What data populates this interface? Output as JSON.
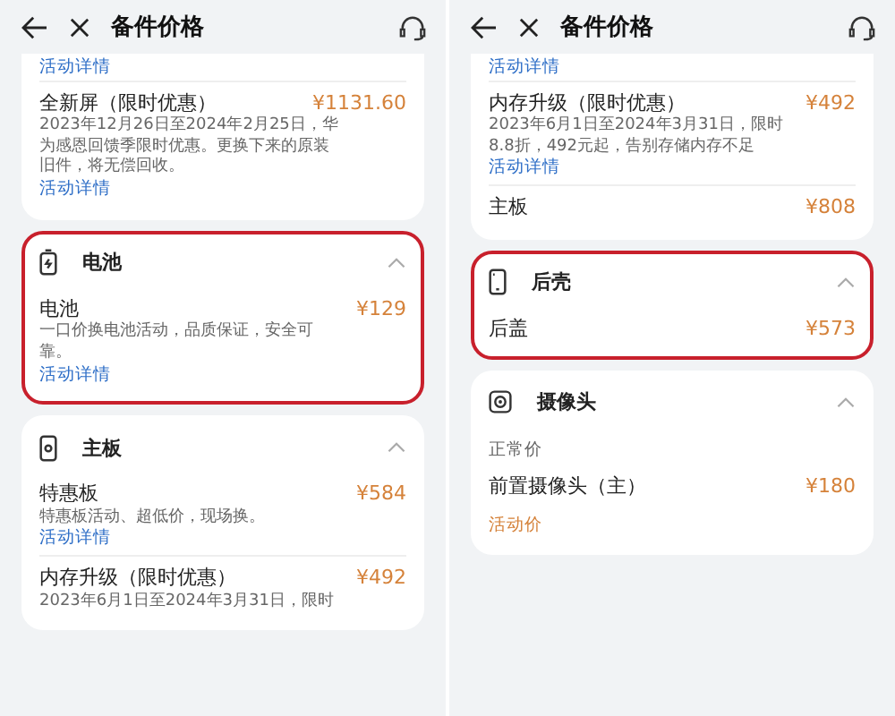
{
  "panels": [
    {
      "title": "备件价格",
      "cards": [
        {
          "highlighted": false,
          "items": [
            {
              "kind": "link",
              "link": "活动详情"
            },
            {
              "kind": "item",
              "name": "全新屏（限时优惠）",
              "price": "¥1131.60",
              "desc": "2023年12月26日至2024年2月25日，华为感恩回馈季限时优惠。更换下来的原装旧件，将无偿回收。",
              "link": "活动详情"
            }
          ]
        },
        {
          "highlighted": true,
          "kind": "battery",
          "title": "电池",
          "expanded": true,
          "items": [
            {
              "kind": "item",
              "name": "电池",
              "price": "¥129",
              "desc": "一口价换电池活动，品质保证，安全可靠。",
              "link": "活动详情"
            }
          ]
        },
        {
          "highlighted": false,
          "kind": "board",
          "title": "主板",
          "expanded": true,
          "items": [
            {
              "kind": "item",
              "name": "特惠板",
              "price": "¥584",
              "desc": "特惠板活动、超低价，现场换。",
              "link": "活动详情"
            },
            {
              "kind": "item",
              "name": "内存升级（限时优惠）",
              "price": "¥492",
              "desc": "2023年6月1日至2024年3月31日，限时"
            }
          ]
        }
      ]
    },
    {
      "title": "备件价格",
      "cards": [
        {
          "highlighted": false,
          "items": [
            {
              "kind": "link",
              "link": "活动详情"
            },
            {
              "kind": "item",
              "name": "内存升级（限时优惠）",
              "price": "¥492",
              "desc": "2023年6月1日至2024年3月31日，限时8.8折，492元起，告别存储内存不足",
              "link": "活动详情"
            },
            {
              "kind": "item",
              "name": "主板",
              "price": "¥808"
            }
          ]
        },
        {
          "highlighted": true,
          "kind": "phone",
          "title": "后壳",
          "expanded": true,
          "items": [
            {
              "kind": "item",
              "name": "后盖",
              "price": "¥573"
            }
          ]
        },
        {
          "highlighted": false,
          "kind": "camera",
          "title": "摄像头",
          "expanded": true,
          "items": [
            {
              "kind": "label",
              "text": "正常价"
            },
            {
              "kind": "item",
              "name": "前置摄像头（主）",
              "price": "¥180"
            },
            {
              "kind": "promo",
              "text": "活动价"
            }
          ]
        }
      ]
    }
  ]
}
